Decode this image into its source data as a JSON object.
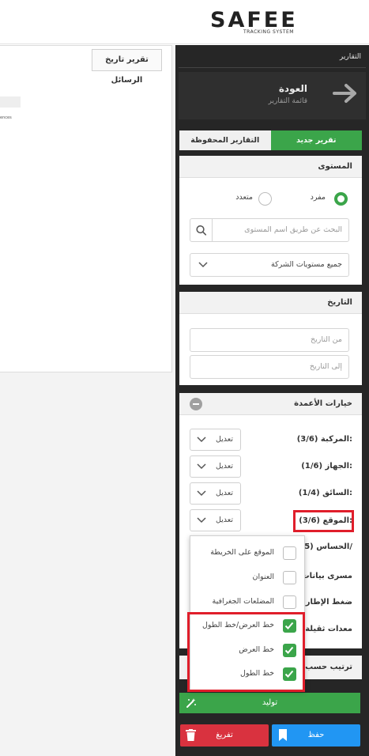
{
  "brand": {
    "logo_text": "SAFEE",
    "logo_subtitle": "TRACKING SYSTEM",
    "accent_color": "#3ba54a"
  },
  "main": {
    "report_tab_label": "تقرير تاريخ الرسائل",
    "preview_snippet": "ences"
  },
  "sidebar": {
    "title": "التقارير",
    "back_title": "العودة",
    "back_subtitle": "قائمة التقارير",
    "tabs": {
      "new_report": "تقرير جديد",
      "saved_reports": "التقارير المحفوظة"
    },
    "level": {
      "heading": "المستوى",
      "single_label": "مفرد",
      "multiple_label": "متعدد",
      "selected": "مفرد",
      "search_placeholder": "البحث عن طريق اسم المستوى",
      "select_value": "جميع مستويات الشركة"
    },
    "date": {
      "heading": "التاريخ",
      "from_placeholder": "من التاريخ",
      "to_placeholder": "إلى التاريخ"
    },
    "columns": {
      "heading": "خيارات الأعمدة",
      "edit_label": "تعديل",
      "rows": [
        {
          "label": "المركبة (3/6):"
        },
        {
          "label": "الجهاز (1/6):"
        },
        {
          "label": "السائق (1/4):"
        },
        {
          "label": "الموقع (3/6):"
        },
        {
          "label": "الحساس (5/"
        },
        {
          "label": "مسرى بيانات"
        },
        {
          "label": "ضغط الإطارات"
        },
        {
          "label": "معدات ثقيلة"
        }
      ]
    },
    "location_options": [
      {
        "label": "الموقع على الخريطة",
        "checked": false
      },
      {
        "label": "العنوان",
        "checked": false
      },
      {
        "label": "المضلعات الجغرافية",
        "checked": false
      },
      {
        "label": "خط العرض/خط الطول",
        "checked": true
      },
      {
        "label": "خط العرض",
        "checked": true
      },
      {
        "label": "خط الطول",
        "checked": true
      }
    ],
    "sort": {
      "heading": "ترتيب حسب"
    },
    "actions": {
      "generate": "توليد",
      "save": "حفظ",
      "clear": "تفريغ"
    }
  }
}
